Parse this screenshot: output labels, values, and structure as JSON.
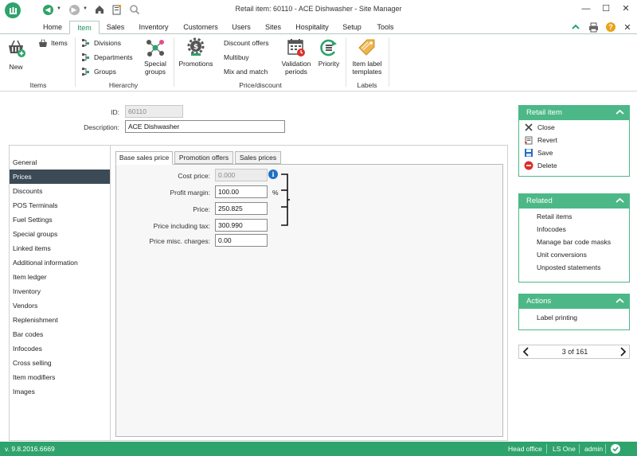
{
  "window": {
    "title": "Retail item: 60110 - ACE Dishwasher - Site Manager",
    "minimize": "—",
    "maximize": "☐",
    "close": "✕"
  },
  "menu": {
    "tabs": [
      "Home",
      "Item",
      "Sales",
      "Inventory",
      "Customers",
      "Users",
      "Sites",
      "Hospitality",
      "Setup",
      "Tools"
    ],
    "active": "Item"
  },
  "ribbon": {
    "new_label": "New",
    "items_label": "Items",
    "divisions_label": "Divisions",
    "departments_label": "Departments",
    "groups_label": "Groups",
    "special_groups_line1": "Special",
    "special_groups_line2": "groups",
    "promotions_label": "Promotions",
    "discount_offers_label": "Discount offers",
    "multibuy_label": "Multibuy",
    "mix_and_match_label": "Mix and match",
    "validation_line1": "Validation",
    "validation_line2": "periods",
    "priority_label": "Priority",
    "item_label_line1": "Item label",
    "item_label_line2": "templates",
    "group_items": "Items",
    "group_hierarchy": "Hierarchy",
    "group_price_discount": "Price/discount",
    "group_labels": "Labels"
  },
  "form": {
    "id_label": "ID:",
    "id_value": "60110",
    "description_label": "Description:",
    "description_value": "ACE Dishwasher"
  },
  "nav": {
    "items": [
      "General",
      "Prices",
      "Discounts",
      "POS Terminals",
      "Fuel Settings",
      "Special groups",
      "Linked items",
      "Additional information",
      "Item ledger",
      "Inventory",
      "Vendors",
      "Replenishment",
      "Bar codes",
      "Infocodes",
      "Cross selling",
      "Item modifiers",
      "Images"
    ],
    "active": "Prices"
  },
  "tabs": {
    "base_sales_price": "Base sales price",
    "promotion_offers": "Promotion offers",
    "sales_prices": "Sales prices"
  },
  "prices": {
    "cost_price_label": "Cost price:",
    "cost_price_value": "0.000",
    "profit_margin_label": "Profit margin:",
    "profit_margin_value": "100.00",
    "percent_sign": "%",
    "price_label": "Price:",
    "price_value": "250.825",
    "price_incl_tax_label": "Price including tax:",
    "price_incl_tax_value": "300.990",
    "misc_charges_label": "Price misc. charges:",
    "misc_charges_value": "0.00"
  },
  "retail_item_panel": {
    "title": "Retail item",
    "close": "Close",
    "revert": "Revert",
    "save": "Save",
    "delete": "Delete"
  },
  "related_panel": {
    "title": "Related",
    "links": [
      "Retail items",
      "Infocodes",
      "Manage bar code masks",
      "Unit conversions",
      "Unposted statements"
    ]
  },
  "actions_panel": {
    "title": "Actions",
    "links": [
      "Label printing"
    ]
  },
  "pager": {
    "text": "3 of 161"
  },
  "status": {
    "version": "v. 9.8.2016.6669",
    "site": "Head office",
    "product": "LS One",
    "user": "admin"
  },
  "colors": {
    "accent": "#2ea36b",
    "panel_header": "#4cb887",
    "nav_selected": "#3b4a55",
    "delete_red": "#d9302c",
    "info_blue": "#1f6fc4",
    "help_orange": "#e8a317"
  }
}
